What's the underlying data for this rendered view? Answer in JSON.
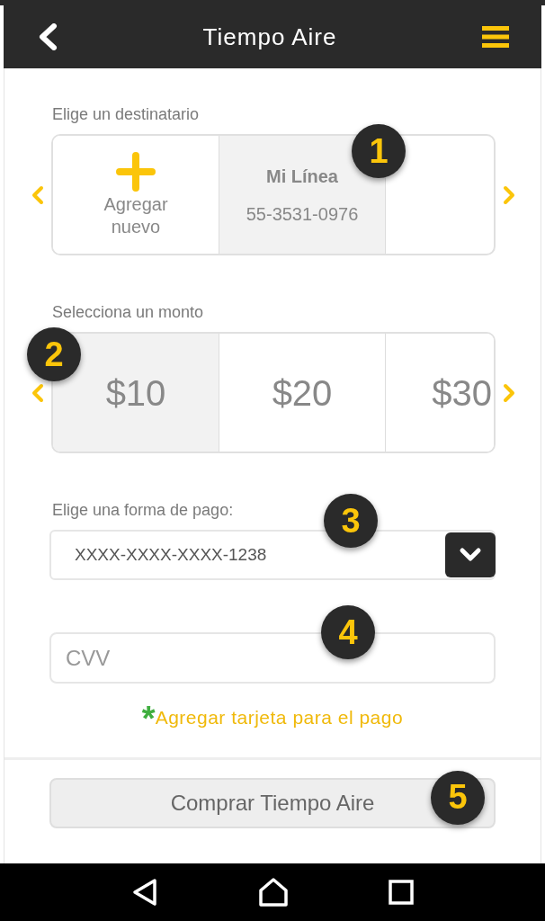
{
  "header": {
    "title": "Tiempo Aire"
  },
  "recipients": {
    "label": "Elige un destinatario",
    "items": [
      {
        "kind": "add",
        "label": "Agregar nuevo",
        "selected": false
      },
      {
        "kind": "line",
        "name": "Mi Línea",
        "number": "55-3531-0976",
        "selected": true
      }
    ]
  },
  "amounts": {
    "label": "Selecciona un monto",
    "items": [
      {
        "value": "$10",
        "selected": true
      },
      {
        "value": "$20",
        "selected": false
      },
      {
        "value": "$30",
        "selected": false
      }
    ]
  },
  "payment": {
    "label": "Elige una forma de pago:",
    "value": "XXXX-XXXX-XXXX-1238"
  },
  "cvv": {
    "placeholder": "CVV"
  },
  "add_card": {
    "mark": "*",
    "text": "Agregar tarjeta para el pago"
  },
  "buy_button": "Comprar Tiempo Aire",
  "badges": [
    "1",
    "2",
    "3",
    "4",
    "5"
  ]
}
